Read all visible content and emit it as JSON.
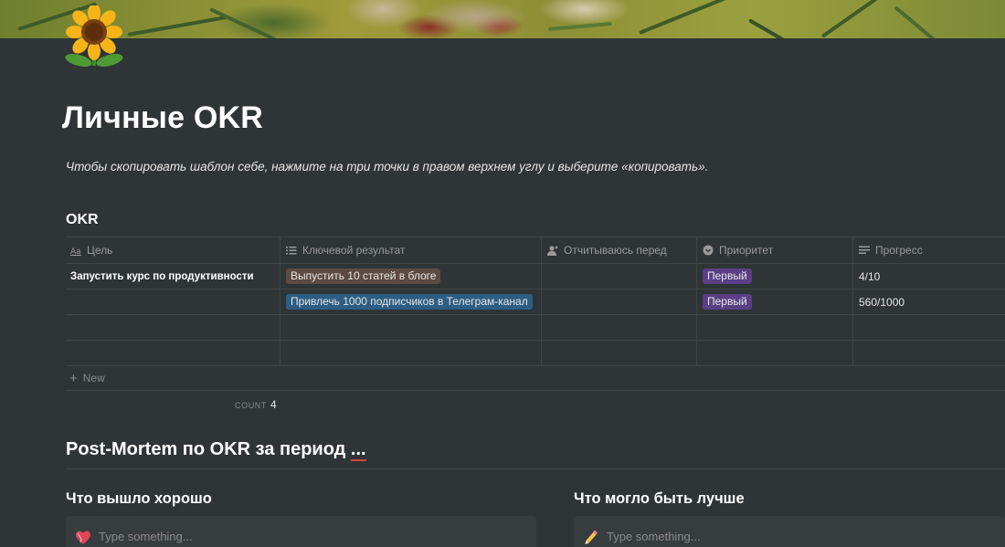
{
  "page": {
    "title": "Личные OKR",
    "subtitle": "Чтобы скопировать шаблон себе, нажмите на три точки в правом верхнем углу и выберите «копировать».",
    "icon": "sunflower-icon"
  },
  "database": {
    "title": "OKR",
    "columns": [
      {
        "label": "Цель",
        "icon": "title-icon"
      },
      {
        "label": "Ключевой результат",
        "icon": "list-icon"
      },
      {
        "label": "Отчитываюсь перед",
        "icon": "person-icon"
      },
      {
        "label": "Приоритет",
        "icon": "select-icon"
      },
      {
        "label": "Прогресс",
        "icon": "text-icon"
      }
    ],
    "rows": [
      {
        "goal": "Запустить курс по продуктивности",
        "key_result": "Выпустить 10 статей в блоге",
        "key_result_color": "#5c4b41",
        "report_to": "",
        "priority": "Первый",
        "progress": "4/10"
      },
      {
        "goal": "",
        "key_result": "Привлечь 1000 подписчиков в Телеграм-канал",
        "key_result_color": "#2c5e84",
        "report_to": "",
        "priority": "Первый",
        "progress": "560/1000"
      },
      {
        "goal": "",
        "key_result": "",
        "report_to": "",
        "priority": "",
        "progress": ""
      },
      {
        "goal": "",
        "key_result": "",
        "report_to": "",
        "priority": "",
        "progress": ""
      }
    ],
    "new_label": "New",
    "count_label": "COUNT",
    "count_value": "4"
  },
  "postmortem": {
    "heading": "Post-Mortem по OKR за период",
    "heading_dots": "...",
    "left": {
      "title": "Что вышло хорошо",
      "placeholder": "Type something...",
      "icon": "heart-icon"
    },
    "right": {
      "title": "Что могло быть лучше",
      "placeholder": "Type something...",
      "icon": "pencil-icon"
    }
  },
  "colors": {
    "background": "#2f3437",
    "tag_purple": "#5a3f86",
    "tag_brown": "#5c4b41",
    "tag_blue": "#2c5e84",
    "spell_underline": "#d2463b"
  }
}
